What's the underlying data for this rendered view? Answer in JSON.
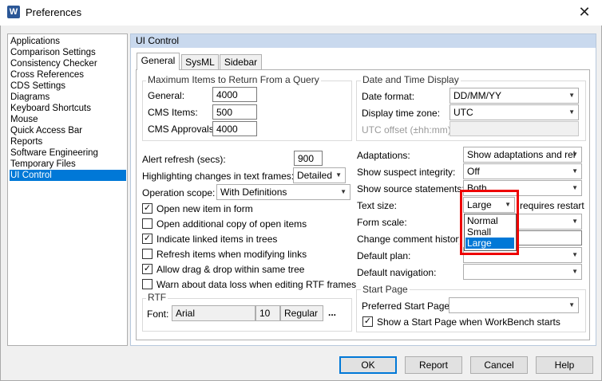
{
  "window": {
    "title": "Preferences",
    "app_icon_letter": "W",
    "close_glyph": "✕"
  },
  "nav": {
    "items": [
      "Applications",
      "Comparison Settings",
      "Consistency Checker",
      "Cross References",
      "CDS Settings",
      "Diagrams",
      "Keyboard Shortcuts",
      "Mouse",
      "Quick Access Bar",
      "Reports",
      "Software Engineering",
      "Temporary Files",
      "UI Control"
    ],
    "selected": "UI Control"
  },
  "panel": {
    "title": "UI Control"
  },
  "tabs": [
    "General",
    "SysML",
    "Sidebar"
  ],
  "max_items": {
    "legend": "Maximum Items to Return From a Query",
    "general_label": "General:",
    "general_value": "4000",
    "cms_items_label": "CMS Items:",
    "cms_items_value": "500",
    "cms_approvals_label": "CMS Approvals:",
    "cms_approvals_value": "4000"
  },
  "date_time": {
    "legend": "Date and Time Display",
    "date_format_label": "Date format:",
    "date_format_value": "DD/MM/YY",
    "tz_label": "Display time zone:",
    "tz_value": "UTC",
    "utc_offset_label": "UTC offset (±hh:mm):",
    "utc_offset_value": ""
  },
  "left": {
    "alert_label": "Alert refresh (secs):",
    "alert_value": "900",
    "highlight_label": "Highlighting changes in text frames:",
    "highlight_value": "Detailed",
    "scope_label": "Operation scope:",
    "scope_value": "With Definitions",
    "checkboxes": [
      {
        "label": "Open new item in form",
        "checked": true
      },
      {
        "label": "Open additional copy of open items",
        "checked": false
      },
      {
        "label": "Indicate linked items in trees",
        "checked": true
      },
      {
        "label": "Refresh items when modifying links",
        "checked": false
      },
      {
        "label": "Allow drag & drop within same tree",
        "checked": true
      },
      {
        "label": "Warn about data loss when editing RTF frames",
        "checked": false
      }
    ]
  },
  "rtf": {
    "legend": "RTF",
    "font_label": "Font:",
    "font_name": "Arial",
    "font_size": "10",
    "font_style": "Regular",
    "more": "..."
  },
  "right": {
    "adaptations_label": "Adaptations:",
    "adaptations_value": "Show adaptations and rel",
    "suspect_label": "Show suspect integrity:",
    "suspect_value": "Off",
    "source_label": "Show source statements:",
    "source_value": "Both",
    "textsize_label": "Text size:",
    "textsize_value": "Large",
    "requires_restart": "requires restart",
    "formscale_label": "Form scale:",
    "comment_label": "Change comment history:",
    "plan_label": "Default plan:",
    "navigation_label": "Default navigation:"
  },
  "text_size_options": [
    "Normal",
    "Small",
    "Large"
  ],
  "text_size_selected": "Large",
  "start_page": {
    "legend": "Start Page",
    "preferred_label": "Preferred Start Page:",
    "preferred_value": "",
    "show_label": "Show a Start Page when WorkBench starts",
    "show_checked": true
  },
  "buttons": {
    "ok": "OK",
    "report": "Report",
    "cancel": "Cancel",
    "help": "Help"
  },
  "glyphs": {
    "check": "✓",
    "dropdown": "▼"
  },
  "colors": {
    "selection": "#0078d7",
    "highlight_box": "#e00000",
    "panel_header": "#c9d9ee"
  }
}
